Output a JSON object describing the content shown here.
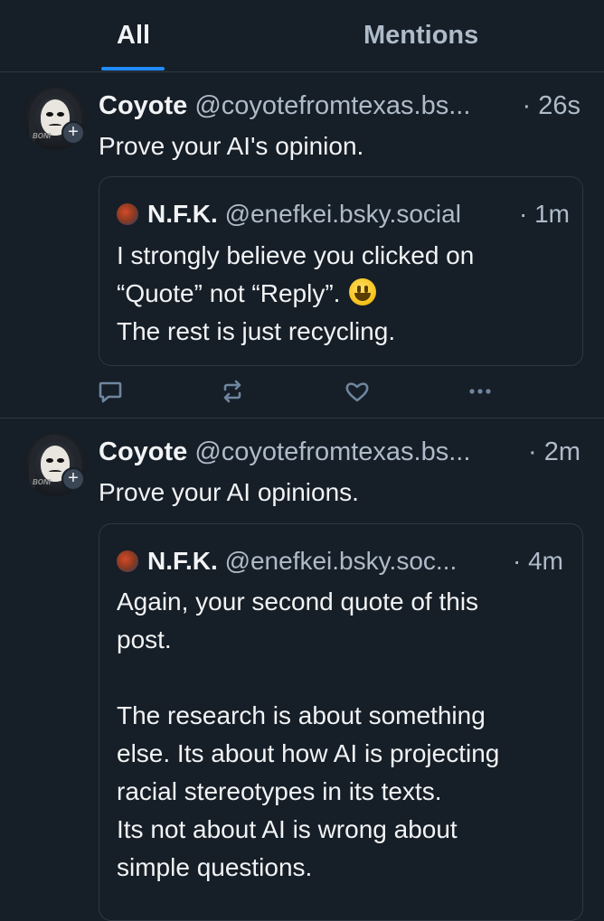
{
  "tabs": [
    {
      "label": "All",
      "active": true
    },
    {
      "label": "Mentions",
      "active": false
    }
  ],
  "colors": {
    "background": "#161e27",
    "accent": "#208bfe",
    "muted_text": "#aebbc9",
    "border": "#2e3843"
  },
  "posts": [
    {
      "author_name": "Coyote",
      "author_handle": "@coyotefromtexas.bs...",
      "time": "· 26s",
      "text": "Prove your AI's opinion.",
      "avatar_signature": "BONI",
      "quote": {
        "author_name": "N.F.K.",
        "author_handle": "@enefkei.bsky.social",
        "time": "· 1m",
        "lines": [
          "I strongly believe you clicked on",
          "“Quote” not “Reply”.",
          "The rest is just recycling."
        ],
        "emoji": "grinning-face-emoji"
      },
      "actions": [
        "reply-icon",
        "repost-icon",
        "like-icon",
        "more-icon"
      ]
    },
    {
      "author_name": "Coyote",
      "author_handle": "@coyotefromtexas.bs...",
      "time": "· 2m",
      "text": "Prove your AI opinions.",
      "avatar_signature": "BONI",
      "quote": {
        "author_name": "N.F.K.",
        "author_handle": "@enefkei.bsky.soc...",
        "time": "· 4m",
        "lines": [
          "Again, your second quote of this",
          "post.",
          "",
          "The research is about something",
          "else. Its about how AI is projecting",
          "racial stereotypes in its texts.",
          "Its not about AI is wrong about",
          "simple questions."
        ]
      }
    }
  ]
}
